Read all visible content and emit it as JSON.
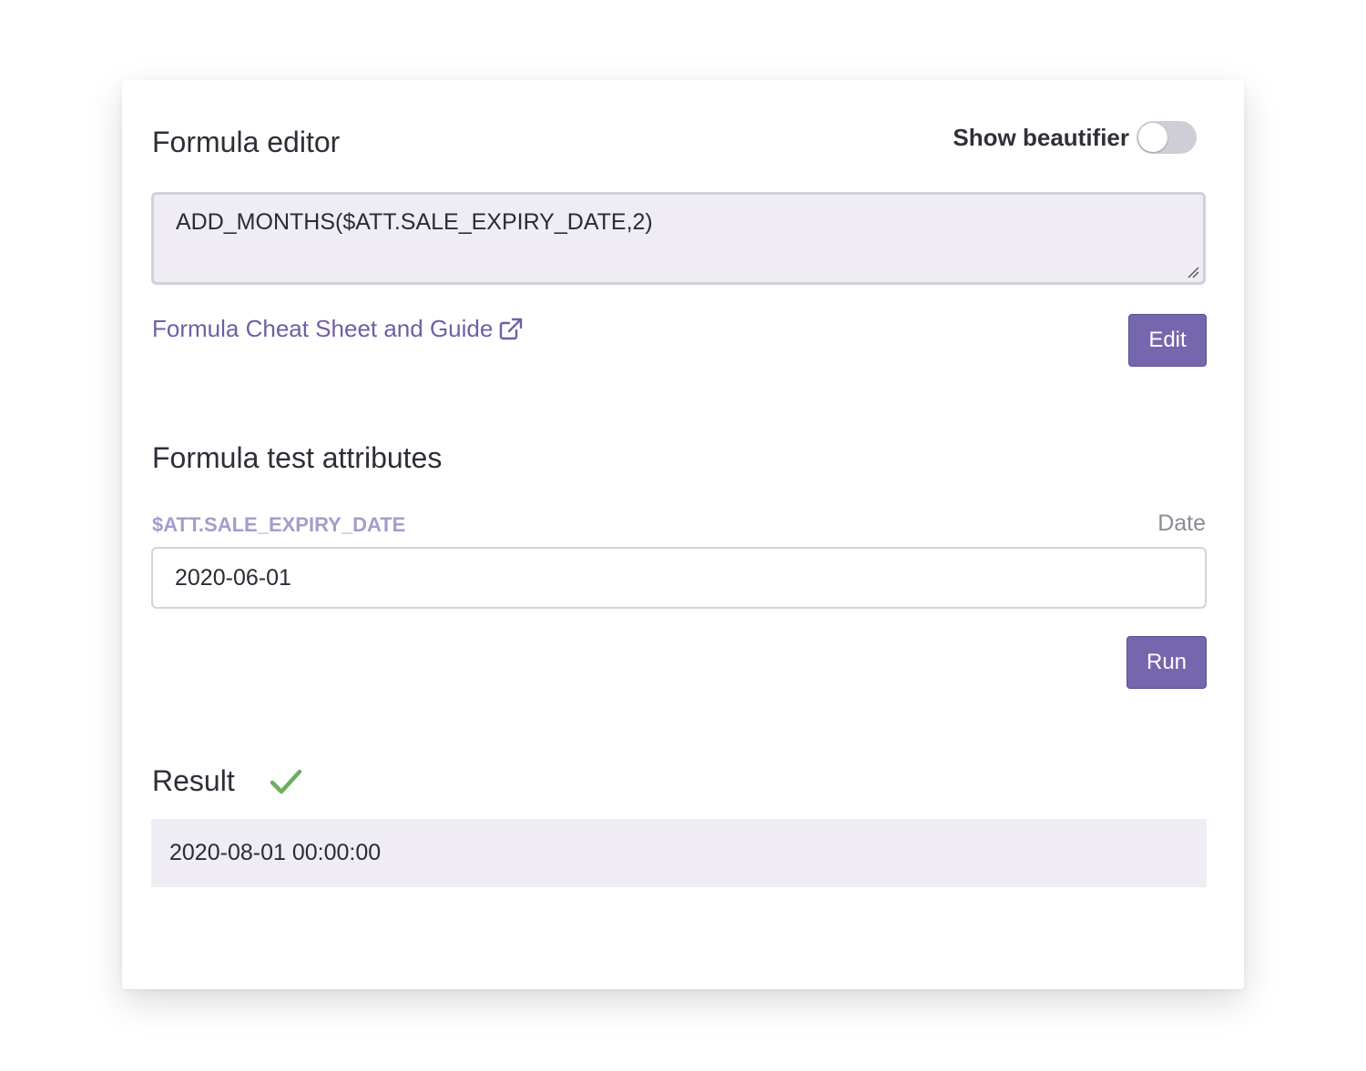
{
  "editor": {
    "title": "Formula editor",
    "beautifier_label": "Show beautifier",
    "beautifier_enabled": false,
    "formula": "ADD_MONTHS($ATT.SALE_EXPIRY_DATE,2)",
    "guide_link": "Formula Cheat Sheet and Guide",
    "guide_link_icon": "external-link-icon",
    "edit_label": "Edit"
  },
  "test_attributes": {
    "title": "Formula test attributes",
    "items": [
      {
        "name": "$ATT.SALE_EXPIRY_DATE",
        "type": "Date",
        "value": "2020-06-01"
      }
    ],
    "run_label": "Run"
  },
  "result": {
    "title": "Result",
    "status_icon": "check-icon",
    "value": "2020-08-01 00:00:00"
  },
  "colors": {
    "accent": "#7566ad",
    "link": "#6f5fa6",
    "attribute_label": "#a59ccb",
    "success": "#6aae5e",
    "field_background": "#efedf3"
  }
}
